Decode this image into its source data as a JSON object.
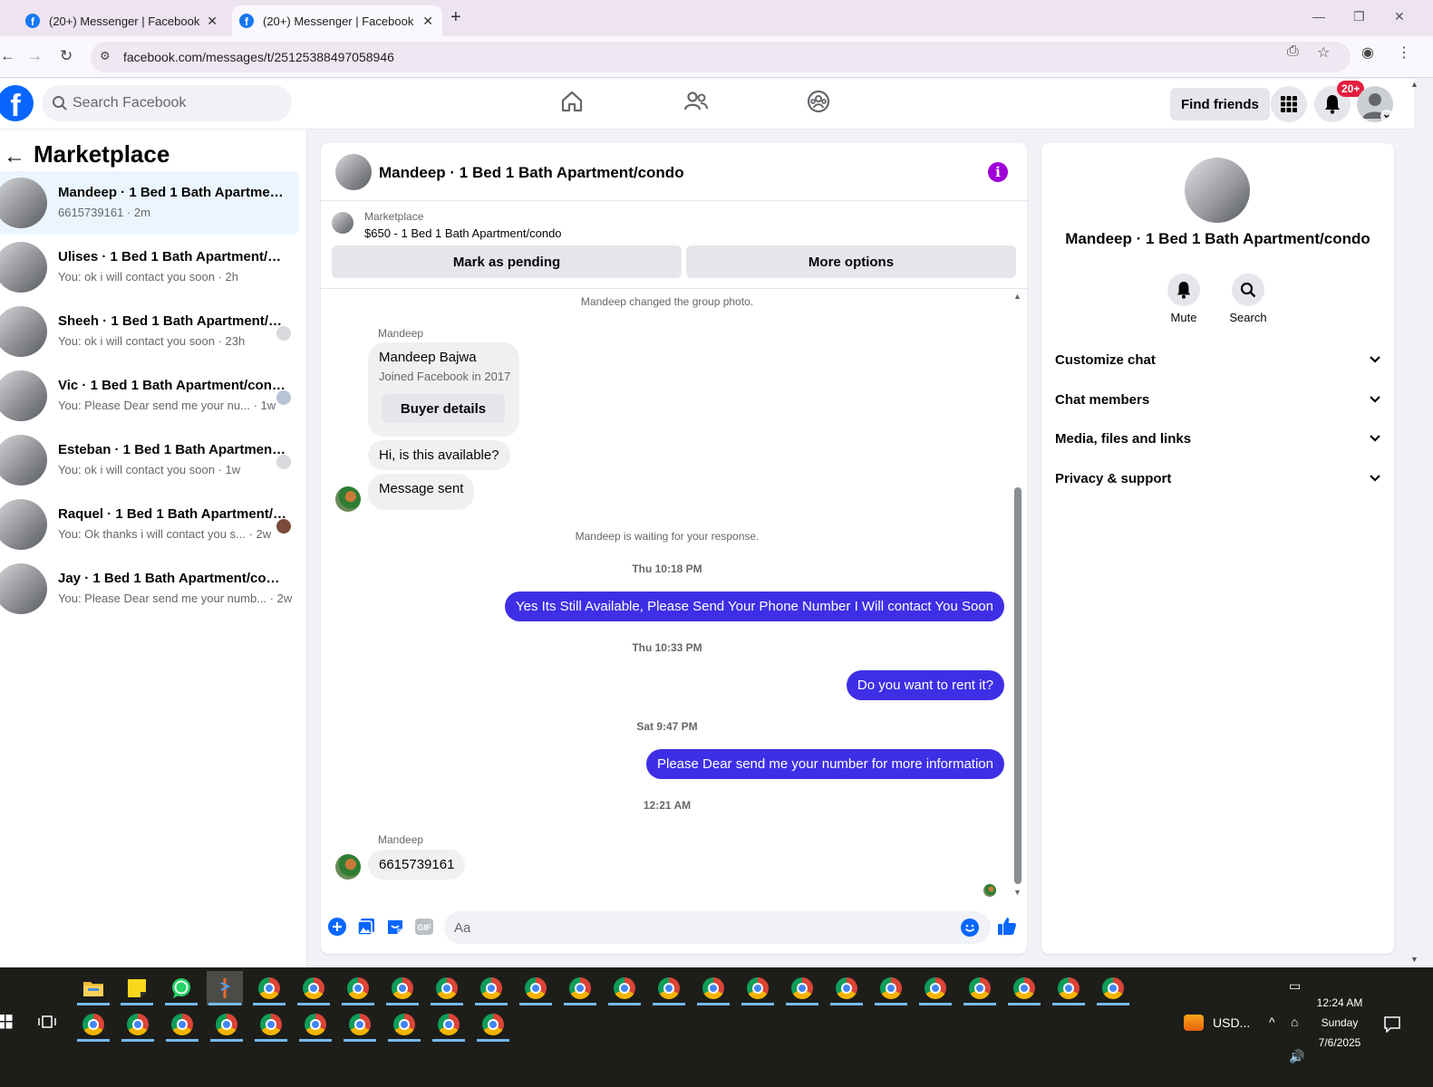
{
  "browser": {
    "tabs": [
      {
        "title": "(20+) Messenger | Facebook"
      },
      {
        "title": "(20+) Messenger | Facebook"
      }
    ],
    "url": "facebook.com/messages/t/25125388497058946"
  },
  "fb_header": {
    "search_placeholder": "Search Facebook",
    "find_friends_label": "Find friends",
    "notification_count": "20+"
  },
  "sidebar": {
    "title": "Marketplace",
    "conversations": [
      {
        "title": "Mandeep · 1 Bed 1 Bath Apartment/condo",
        "preview": "6615739161",
        "time": "2m",
        "active": true
      },
      {
        "title": "Ulises · 1 Bed 1 Bath Apartment/condo",
        "preview": "You: ok i will contact you soon",
        "time": "2h"
      },
      {
        "title": "Sheeh · 1 Bed 1 Bath Apartment/condo",
        "preview": "You: ok i will contact you soon",
        "time": "23h"
      },
      {
        "title": "Vic · 1 Bed 1 Bath Apartment/condo",
        "preview": "You: Please Dear send me your nu...",
        "time": "1w"
      },
      {
        "title": "Esteban · 1 Bed 1 Bath Apartment/condo",
        "preview": "You: ok i will contact you soon",
        "time": "1w"
      },
      {
        "title": "Raquel · 1 Bed 1 Bath Apartment/condo",
        "preview": "You: Ok thanks i will contact you s...",
        "time": "2w"
      },
      {
        "title": "Jay · 1 Bed 1 Bath Apartment/condo",
        "preview": "You: Please Dear send me your numb...",
        "time": "2w"
      }
    ]
  },
  "chat": {
    "title": "Mandeep · 1 Bed 1 Bath Apartment/condo",
    "marketplace_label": "Marketplace",
    "listing": "$650 - 1 Bed 1 Bath Apartment/condo",
    "mark_pending_label": "Mark as pending",
    "more_options_label": "More options",
    "group_photo_notice": "Mandeep changed the group photo.",
    "sender_name": "Mandeep",
    "profile_card": {
      "name": "Mandeep Bajwa",
      "joined": "Joined Facebook in 2017",
      "button": "Buyer details"
    },
    "incoming_1": "Hi, is this available?",
    "incoming_2": "Message sent",
    "waiting_notice": "Mandeep is waiting for your response.",
    "ts_1": "Thu 10:18 PM",
    "outgoing_1": "Yes Its Still Available, Please Send Your Phone Number I Will contact You Soon",
    "ts_2": "Thu 10:33 PM",
    "outgoing_2": "Do you want to rent it?",
    "ts_3": "Sat 9:47 PM",
    "outgoing_3": "Please Dear send me your number for more information",
    "ts_4": "12:21 AM",
    "sender_name_2": "Mandeep",
    "incoming_3": "6615739161",
    "composer_placeholder": "Aa"
  },
  "info_panel": {
    "title": "Mandeep · 1 Bed 1 Bath Apartment/condo",
    "mute_label": "Mute",
    "search_label": "Search",
    "sections": [
      "Customize chat",
      "Chat members",
      "Media, files and links",
      "Privacy & support"
    ]
  },
  "taskbar": {
    "ticker": "USD...",
    "time": "12:24 AM",
    "day": "Sunday",
    "date": "7/6/2025"
  },
  "colors": {
    "fb_blue": "#0866ff",
    "outgoing_bubble": "#3e2fe6",
    "info_icon": "#a000d8",
    "notification_red": "#e41e3f"
  }
}
